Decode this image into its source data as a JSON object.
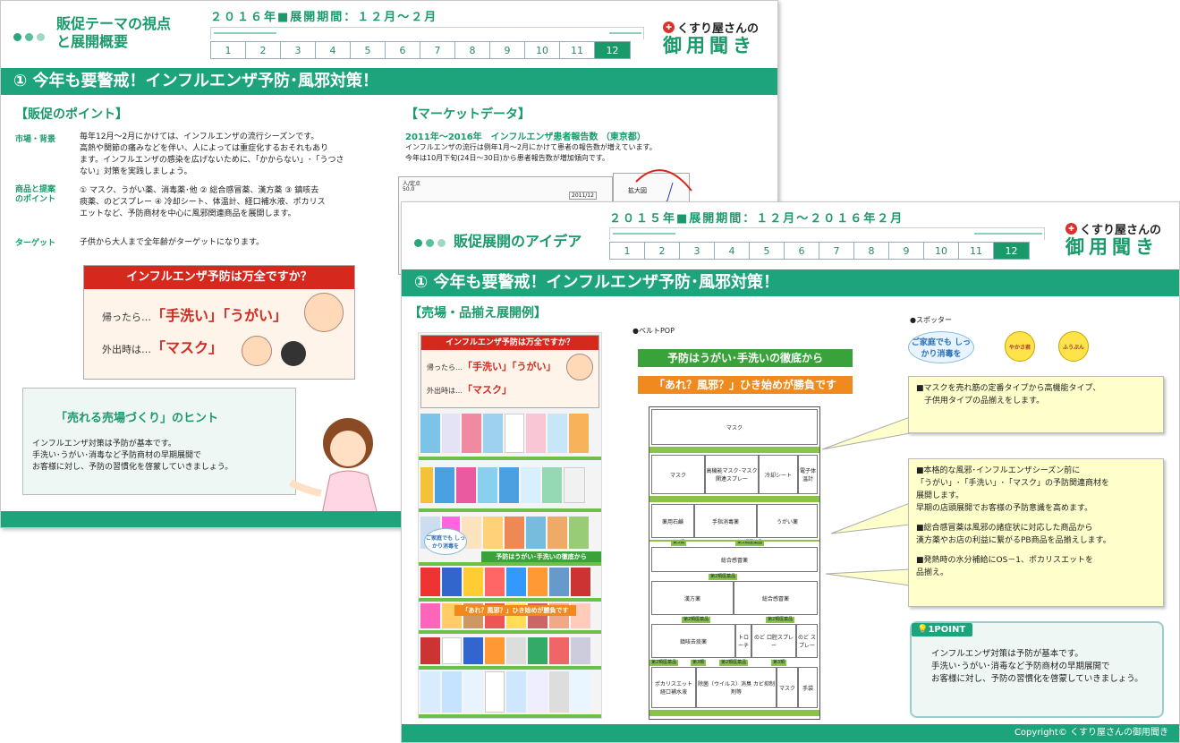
{
  "back": {
    "title_line1": "販促テーマの視点",
    "title_line2": "と展開概要",
    "period": "２０１６年■展開期間：１２月～２月",
    "months": [
      "1",
      "2",
      "3",
      "4",
      "5",
      "6",
      "7",
      "8",
      "9",
      "10",
      "11",
      "12"
    ],
    "active_month": "12",
    "logo_line1": "くすり屋さんの",
    "logo_line2": "御用聞き",
    "banner": "① 今年も要警戒！インフルエンザ予防･風邪対策！",
    "points_heading": "【販促のポイント】",
    "market_label": "市場・背景",
    "market_text": [
      "毎年12月～2月にかけては、インフルエンザの流行シーズンです。",
      "高熱や関節の痛みなどを伴い、人によっては重症化するおそれもあり",
      "ます。インフルエンザの感染を広げないために、「かからない」･「うつさ",
      "ない」対策を実践しましょう。"
    ],
    "product_label_1": "商品と提案",
    "product_label_2": "のポイント",
    "product_text": [
      "① マスク、うがい薬、消毒薬･他 ② 総合感冒薬、漢方薬 ③ 鎮咳去",
      "痰薬、のどスプレー ④ 冷却シート、体温計、経口補水液、ポカリス",
      "エットなど、予防商材を中心に風邪関連商品を展開します。"
    ],
    "target_label": "ターゲット",
    "target_text": "子供から大人まで全年齢がターゲットになります。",
    "flu_header": "インフルエンザ予防は万全ですか？",
    "flu_line1_prefix": "帰ったら…",
    "flu_line1_main": "「手洗い」「うがい」",
    "flu_line2_prefix": "外出時は…",
    "flu_line2_main": "「マスク」",
    "hint_title": "「売れる売場づくり」のヒント",
    "hint_text": [
      "インフルエンザ対策は予防が基本です。",
      "手洗い･うがい･消毒など予防商材の早期展開で",
      "お客様に対し、予防の習慣化を啓蒙していきましょう。"
    ],
    "market_heading": "【マーケットデータ】",
    "market_sub": "2011年～2016年　インフルエンザ患者報告数 （東京都）",
    "market_desc": [
      "インフルエンザの流行は例年1月～2月にかけて患者の報告数が増えています。",
      "今年は10月下旬(24日～30日)から患者報告数が増加傾向です。"
    ],
    "chart_axis_label": "人/定点",
    "chart_tick": "50.0",
    "chart_legend": "2011/12",
    "chart_zoom_label": "拡大図"
  },
  "front": {
    "title": "販促展開のアイデア",
    "period": "２０１５年■展開期間：１２月～２０１６年２月",
    "months": [
      "1",
      "2",
      "3",
      "4",
      "5",
      "6",
      "7",
      "8",
      "9",
      "10",
      "11",
      "12"
    ],
    "active_month": "12",
    "logo_line1": "くすり屋さんの",
    "logo_line2": "御用聞き",
    "banner": "① 今年も要警戒！インフルエンザ予防･風邪対策！",
    "layout_heading": "【売場・品揃え展開例】",
    "shelf_pop_header": "インフルエンザ予防は万全ですか？",
    "shelf_pop_line1_prefix": "帰ったら…",
    "shelf_pop_line1_main": "「手洗い」「うがい」",
    "shelf_pop_line2_prefix": "外出時は…",
    "shelf_pop_line2_main": "「マスク」",
    "shelf_spotter": "ご家庭でも しっかり消毒を",
    "shelf_belt1": "予防はうがい･手洗いの徹底から",
    "shelf_belt2": "「あれ？風邪？」ひき始めが勝負です",
    "belt_label": "●ベルトPOP",
    "belt1": "予防はうがい･手洗いの徹底から",
    "belt2": "「あれ？風邪？」ひき始めが勝負です",
    "spotter_label": "●スポッター",
    "spotter1": "ご家庭でも しっかり消毒を",
    "spotter2": "やかさ君",
    "spotter3": "ふうぶん",
    "plan": {
      "mask_top": "マスク",
      "row2": [
        "マスク",
        "高機能マスク･マスク関連スプレー",
        "冷却シート",
        "電子体温計"
      ],
      "row3": [
        "薬用石鹸",
        "手指消毒薬",
        "うがい薬"
      ],
      "label_a": [
        "第3類",
        "第3類医薬品"
      ],
      "row4": "総合感冒薬",
      "label_b": "第2類医薬品",
      "row5": [
        "漢方薬",
        "総合感冒薬"
      ],
      "label_c": [
        "第2類医薬品",
        "第2類医薬品"
      ],
      "row6": [
        "鎮咳去痰薬",
        "トローチ",
        "のど 口腔スプレー",
        "のど スプレー"
      ],
      "label_d": [
        "第2類医薬品",
        "第3類",
        "第2類医薬品",
        "第3類"
      ],
      "row7": [
        "ポカリスエット 経口補水液",
        "除菌（ウイルス）消臭 カビ抑制剤等",
        "マスク",
        "手袋"
      ]
    },
    "note1": [
      "■マスクを売れ筋の定番タイプから高機能タイプ、",
      "　子供用タイプの品揃えをします。"
    ],
    "note2": [
      "■本格的な風邪･インフルエンザシーズン前に",
      "「うがい」･「手洗い」･「マスク」の予防関連商材を",
      "展開します。",
      "早期の店頭展開でお客様の予防意識を高めます。",
      "",
      "■総合感冒薬は風邪の諸症状に対応した商品から",
      "漢方薬やお店の利益に繋がるPB商品を品揃えします。",
      "",
      "■発熱時の水分補給にOS－1、ポカリスエットを",
      "品揃え。"
    ],
    "point_tag": "1POINT",
    "point_text": [
      "インフルエンザ対策は予防が基本です。",
      "手洗い･うがい･消毒など予防商材の早期展開で",
      "お客様に対し、予防の習慣化を啓蒙していきましょう。"
    ],
    "copyright": "Copyright© くすり屋さんの御用聞き"
  },
  "colors": {
    "brand_green": "#1ea47c",
    "accent_red": "#d7281e",
    "note_yellow": "#ffffcc",
    "belt_green": "#3aa23a",
    "belt_orange": "#f08a1e"
  }
}
